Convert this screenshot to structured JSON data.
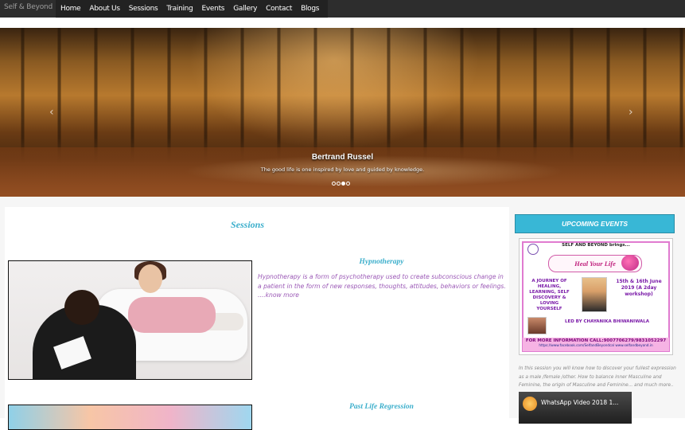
{
  "brand": "Self & Beyond",
  "nav": {
    "items": [
      "Home",
      "About Us",
      "Sessions",
      "Training",
      "Events",
      "Gallery",
      "Contact",
      "Blogs"
    ]
  },
  "carousel": {
    "prev_icon": "chevron-left",
    "next_icon": "chevron-right",
    "prev_glyph": "‹",
    "next_glyph": "›",
    "caption_title": "Bertrand Russel",
    "caption_text": "The good life is one inspired by love and guided by knowledge.",
    "active_slide_index": 2,
    "slide_count": 4
  },
  "sessions": {
    "heading": "Sessions",
    "items": [
      {
        "title": "Hypnotherapy",
        "description": "Hypnotherapy is a form of psychotherapy used to create subconscious change in a patient in the form of new responses, thoughts, attitudes, behaviors or feelings.",
        "more_link": "....know more"
      },
      {
        "title": "Past Life Regression"
      }
    ]
  },
  "sidebar": {
    "heading": "UPCOMING EVENTS",
    "poster": {
      "brings": "SELF AND BEYOND brings...",
      "title": "Heal Your Life",
      "journey": "A JOURNEY OF HEALING, LEARNING, SELF DISCOVERY & LOVING YOURSELF",
      "dates": "15th & 16th June 2019 (A 2day workshop)",
      "led_by": "LED BY CHAYANIKA BHIWANIWALA",
      "info": "FOR MORE INFORMATION CALL:9007706279/9831052297",
      "links": "https://www.facebook.com/SelfandBeyondcal www.selfandbeyond.in"
    },
    "event_description": "In this session you will know how to discover your fullest expression as a male /female /other. How to balance inner Masculine and Feminine, the origin of Masculine and Feminine... and much more..",
    "video_title": "WhatsApp Video 2018 1..."
  },
  "colors": {
    "nav_bg": "#222222",
    "accent": "#38b7d6",
    "purple_text": "#9b59b6"
  }
}
